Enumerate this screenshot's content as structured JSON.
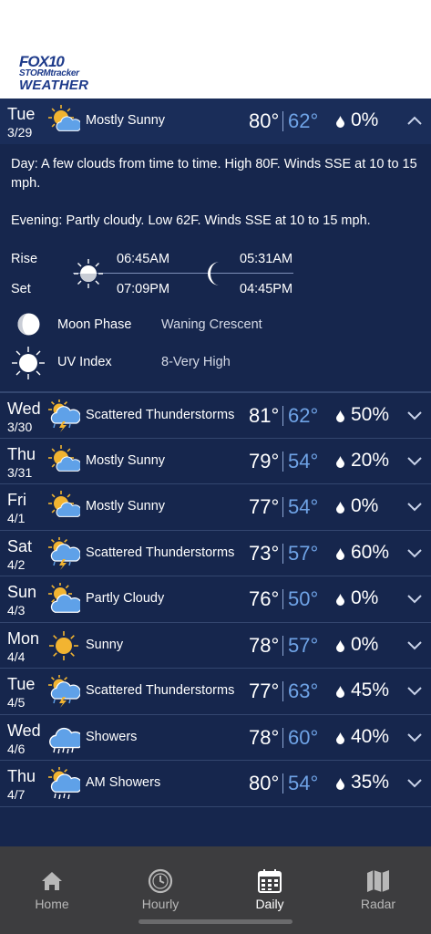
{
  "brand": {
    "line1": "FOX10",
    "line2": "STORMtracker",
    "line3": "WEATHER"
  },
  "expanded": {
    "day": "Tue",
    "date": "3/29",
    "condition": "Mostly Sunny",
    "icon": "mostly-sunny-icon",
    "high": "80°",
    "low": "62°",
    "precip": "0%",
    "day_label": "Day",
    "day_text": ": A few clouds from time to time. High 80F. Winds SSE at 10 to 15 mph.",
    "evening_label": "Evening",
    "evening_text": ": Partly cloudy. Low 62F. Winds SSE at 10 to 15 mph.",
    "rise_label": "Rise",
    "set_label": "Set",
    "sunrise": "06:45AM",
    "sunset": "07:09PM",
    "moonrise": "05:31AM",
    "moonset": "04:45PM",
    "moon_phase_label": "Moon Phase",
    "moon_phase": "Waning Crescent",
    "uv_label": "UV Index",
    "uv_value": "8-Very High"
  },
  "days": [
    {
      "day": "Wed",
      "date": "3/30",
      "condition": "Scattered Thunderstorms",
      "icon": "thunderstorm-icon",
      "high": "81°",
      "low": "62°",
      "precip": "50%"
    },
    {
      "day": "Thu",
      "date": "3/31",
      "condition": "Mostly Sunny",
      "icon": "mostly-sunny-icon",
      "high": "79°",
      "low": "54°",
      "precip": "20%"
    },
    {
      "day": "Fri",
      "date": "4/1",
      "condition": "Mostly Sunny",
      "icon": "mostly-sunny-icon",
      "high": "77°",
      "low": "54°",
      "precip": "0%"
    },
    {
      "day": "Sat",
      "date": "4/2",
      "condition": "Scattered Thunderstorms",
      "icon": "thunderstorm-icon",
      "high": "73°",
      "low": "57°",
      "precip": "60%"
    },
    {
      "day": "Sun",
      "date": "4/3",
      "condition": "Partly Cloudy",
      "icon": "partly-cloudy-icon",
      "high": "76°",
      "low": "50°",
      "precip": "0%"
    },
    {
      "day": "Mon",
      "date": "4/4",
      "condition": "Sunny",
      "icon": "sunny-icon",
      "high": "78°",
      "low": "57°",
      "precip": "0%"
    },
    {
      "day": "Tue",
      "date": "4/5",
      "condition": "Scattered Thunderstorms",
      "icon": "thunderstorm-icon",
      "high": "77°",
      "low": "63°",
      "precip": "45%"
    },
    {
      "day": "Wed",
      "date": "4/6",
      "condition": "Showers",
      "icon": "showers-icon",
      "high": "78°",
      "low": "60°",
      "precip": "40%"
    },
    {
      "day": "Thu",
      "date": "4/7",
      "condition": "AM Showers",
      "icon": "am-showers-icon",
      "high": "80°",
      "low": "54°",
      "precip": "35%"
    }
  ],
  "nav": [
    {
      "label": "Home",
      "icon": "home-icon",
      "active": false
    },
    {
      "label": "Hourly",
      "icon": "clock-icon",
      "active": false
    },
    {
      "label": "Daily",
      "icon": "calendar-icon",
      "active": true
    },
    {
      "label": "Radar",
      "icon": "map-icon",
      "active": false
    }
  ],
  "colors": {
    "background": "#16264d",
    "low_temp": "#6fa3e6",
    "nav_bg": "#3d3d3f",
    "nav_active": "#ffffff",
    "nav_inactive": "#b8b8b8"
  }
}
